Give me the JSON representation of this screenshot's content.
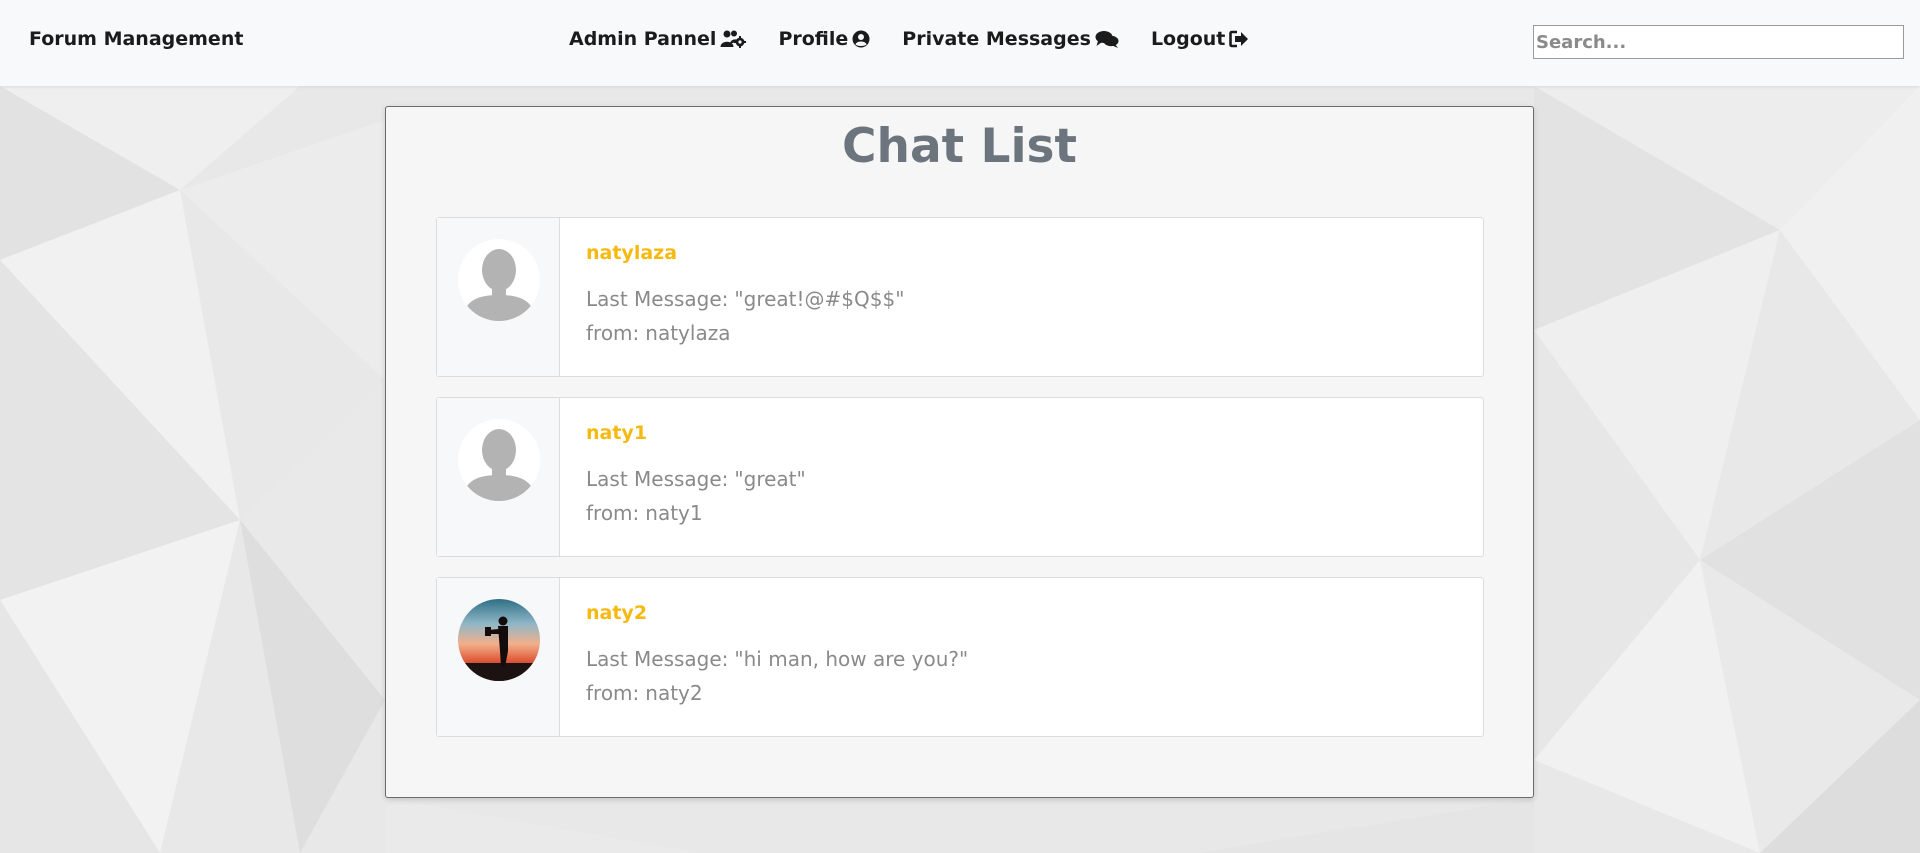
{
  "navbar": {
    "brand": "Forum Management",
    "links": [
      {
        "label": "Admin Pannel",
        "icon": "users-cog-icon"
      },
      {
        "label": "Profile",
        "icon": "user-circle-icon"
      },
      {
        "label": "Private Messages",
        "icon": "comments-icon"
      },
      {
        "label": "Logout",
        "icon": "sign-out-icon"
      }
    ],
    "search_placeholder": "Search..."
  },
  "page": {
    "title": "Chat List"
  },
  "chats": [
    {
      "name": "natylaza",
      "message_prefix": "Last Message:",
      "message": "\"great!@#$Q$$\"",
      "from_prefix": "from:",
      "from": "natylaza",
      "avatar": "default-avatar"
    },
    {
      "name": "naty1",
      "message_prefix": "Last Message:",
      "message": "\"great\"",
      "from_prefix": "from:",
      "from": "naty1",
      "avatar": "default-avatar"
    },
    {
      "name": "naty2",
      "message_prefix": "Last Message:",
      "message": "\"hi man, how are you?\"",
      "from_prefix": "from:",
      "from": "naty2",
      "avatar": "photo-avatar"
    }
  ],
  "colors": {
    "accent": "#f5b90f",
    "title": "#6c757d",
    "muted_text": "#8a8a8a"
  }
}
